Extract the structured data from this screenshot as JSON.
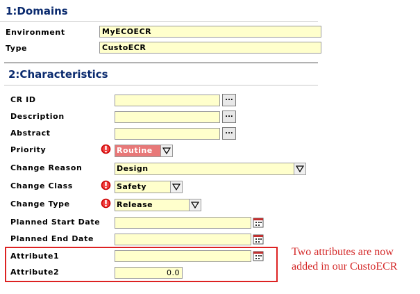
{
  "domains": {
    "title": "1:Domains",
    "environment": {
      "label": "Environment",
      "value": "MyECOECR"
    },
    "type": {
      "label": "Type",
      "value": "CustoECR"
    }
  },
  "characteristics": {
    "title": "2:Characteristics",
    "cr_id": {
      "label": "CR ID",
      "value": "",
      "button": "..."
    },
    "description": {
      "label": "Description",
      "value": "",
      "button": "..."
    },
    "abstract": {
      "label": "Abstract",
      "value": "",
      "button": "..."
    },
    "priority": {
      "label": "Priority",
      "value": "Routine"
    },
    "change_reason": {
      "label": "Change Reason",
      "value": "Design"
    },
    "change_class": {
      "label": "Change Class",
      "value": "Safety"
    },
    "change_type": {
      "label": "Change Type",
      "value": "Release"
    },
    "planned_start_date": {
      "label": "Planned Start Date",
      "value": ""
    },
    "planned_end_date": {
      "label": "Planned End Date",
      "value": ""
    },
    "attribute1": {
      "label": "Attribute1",
      "value": ""
    },
    "attribute2": {
      "label": "Attribute2",
      "value": "0.0"
    }
  },
  "annotation": {
    "line1": "Two attributes are now",
    "line2": "added in our CustoECR"
  },
  "colors": {
    "section_title": "#0a2a6e",
    "field_bg": "#ffffcc",
    "priority_bg": "#e87878",
    "required_icon": "#cc0000",
    "annotation": "#d42a2a"
  },
  "icons": {
    "required": "exclamation-icon",
    "calendar": "calendar-icon",
    "dropdown": "chevron-down-icon"
  }
}
